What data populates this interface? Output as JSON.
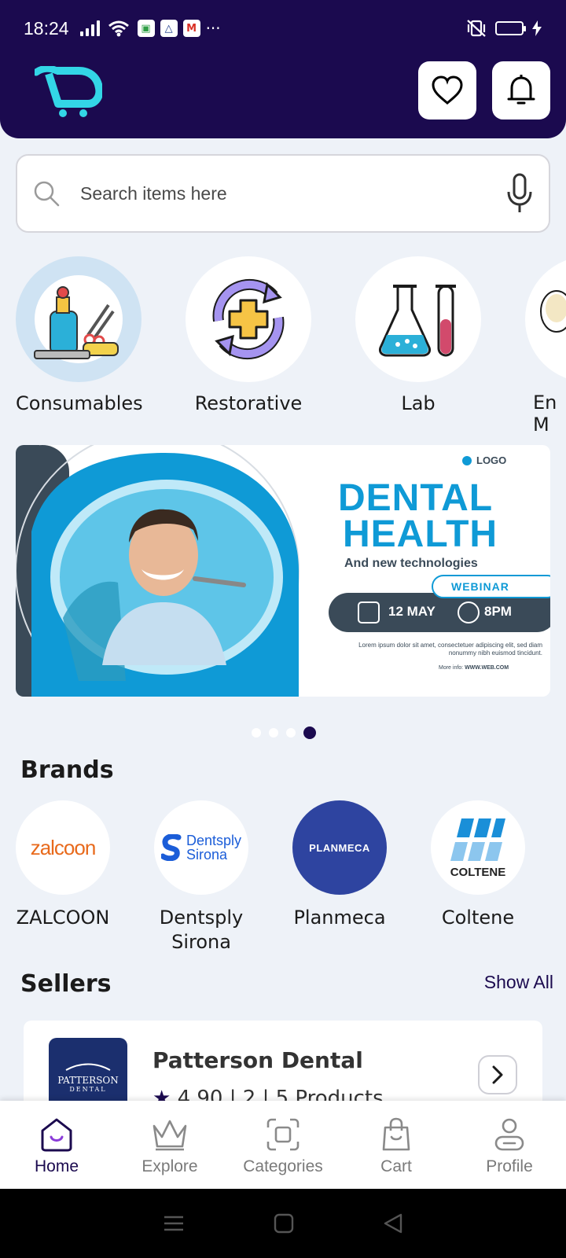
{
  "status_bar": {
    "time": "18:24",
    "more": "···"
  },
  "header": {
    "favorites_label": "favorites",
    "notifications_label": "notifications"
  },
  "search": {
    "placeholder": "Search items here"
  },
  "categories": [
    {
      "label": "Consumables"
    },
    {
      "label": "Restorative"
    },
    {
      "label": "Lab"
    },
    {
      "label": "En\nM"
    }
  ],
  "banner": {
    "title_line1": "DENTAL",
    "title_line2": "HEALTH",
    "subtitle": "And new technologies",
    "badge": "WEBINAR",
    "date": "12 MAY",
    "time": "8PM",
    "logo": "LOGO",
    "body": "Lorem ipsum dolor sit amet, consectetuer adipiscing elit, sed diam nonummy nibh euismod tincidunt.",
    "more_info": "More info:",
    "url": "WWW.WEB.COM",
    "dot_count": 4,
    "active_dot": 4
  },
  "brands": {
    "title": "Brands",
    "items": [
      {
        "label": "ZALCOON",
        "logo_text": "zalcoon"
      },
      {
        "label": "Dentsply\nSirona",
        "logo_text": "Dentsply\nSirona"
      },
      {
        "label": "Planmeca",
        "logo_text": "PLANMECA"
      },
      {
        "label": "Coltene",
        "logo_text": "COLTENE"
      }
    ]
  },
  "sellers": {
    "title": "Sellers",
    "show_all": "Show All",
    "items": [
      {
        "name": "Patterson Dental",
        "rating": "4.90 | 2 | 5 Products",
        "logo_line1": "PATTERSON",
        "logo_line2": "DENTAL"
      }
    ]
  },
  "bottom_nav": [
    {
      "label": "Home",
      "active": true
    },
    {
      "label": "Explore",
      "active": false
    },
    {
      "label": "Categories",
      "active": false
    },
    {
      "label": "Cart",
      "active": false
    },
    {
      "label": "Profile",
      "active": false
    }
  ],
  "colors": {
    "brand_dark": "#1b0a4f",
    "accent_cyan": "#33d6e6",
    "banner_blue": "#0f9ad6",
    "planmeca_blue": "#2e44a0"
  }
}
